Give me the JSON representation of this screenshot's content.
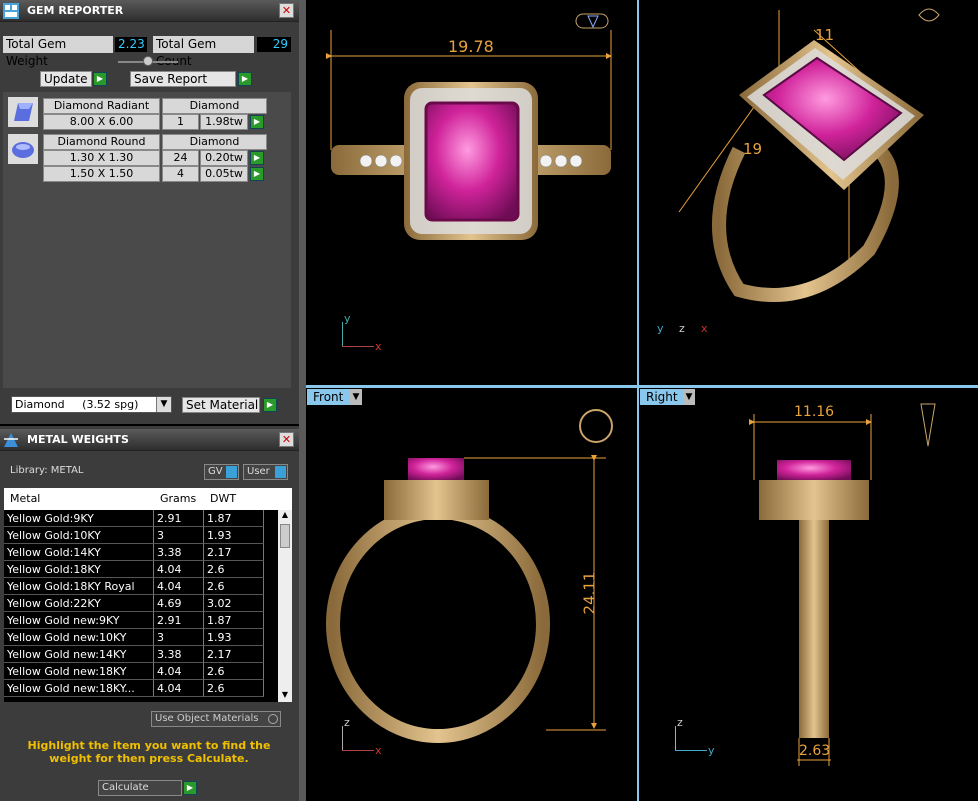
{
  "gem_reporter": {
    "title": "GEM REPORTER",
    "close": "✕",
    "total_weight_label": "Total Gem Weight",
    "total_weight": "2.23",
    "total_count_label": "Total Gem Count",
    "total_count": "29",
    "update_label": "Update",
    "save_label": "Save Report",
    "gems": [
      {
        "name": "Diamond Radiant",
        "material": "Diamond",
        "rows": [
          {
            "size": "8.00 X 6.00",
            "count": "1",
            "weight": "1.98tw"
          }
        ]
      },
      {
        "name": "Diamond Round",
        "material": "Diamond",
        "rows": [
          {
            "size": "1.30 X 1.30",
            "count": "24",
            "weight": "0.20tw"
          },
          {
            "size": "1.50 X 1.50",
            "count": "4",
            "weight": "0.05tw"
          }
        ]
      }
    ],
    "material_select": "Diamond     (3.52 spg)",
    "set_material_label": "Set Material"
  },
  "metal_weights": {
    "title": "METAL WEIGHTS",
    "close": "✕",
    "library_label": "Library: METAL",
    "gv_label": "GV",
    "user_label": "User",
    "columns": [
      "Metal",
      "Grams",
      "DWT"
    ],
    "rows": [
      [
        "Yellow Gold:9KY",
        "2.91",
        "1.87"
      ],
      [
        "Yellow Gold:10KY",
        "3",
        "1.93"
      ],
      [
        "Yellow Gold:14KY",
        "3.38",
        "2.17"
      ],
      [
        "Yellow Gold:18KY",
        "4.04",
        "2.6"
      ],
      [
        "Yellow Gold:18KY Royal",
        "4.04",
        "2.6"
      ],
      [
        "Yellow Gold:22KY",
        "4.69",
        "3.02"
      ],
      [
        "Yellow Gold new:9KY",
        "2.91",
        "1.87"
      ],
      [
        "Yellow Gold new:10KY",
        "3",
        "1.93"
      ],
      [
        "Yellow Gold new:14KY",
        "3.38",
        "2.17"
      ],
      [
        "Yellow Gold new:18KY",
        "4.04",
        "2.6"
      ],
      [
        "Yellow Gold new:18KY...",
        "4.04",
        "2.6"
      ]
    ],
    "use_object_label": "Use Object Materials",
    "hint": "Highlight the item you want to find the weight for then press Calculate.",
    "calculate_label": "Calculate"
  },
  "viewports": {
    "top": {
      "dim": "19.78",
      "ax1": "y",
      "ax2": "x"
    },
    "persp": {
      "dim1": "11",
      "dim2": "19",
      "ax1": "y",
      "ax2": "z",
      "ax3": "x"
    },
    "front": {
      "label": "Front",
      "dim": "24.11",
      "ax1": "z",
      "ax2": "x"
    },
    "right": {
      "label": "Right",
      "dim1": "11.16",
      "dim2": "2.63",
      "ax1": "z",
      "ax2": "y"
    }
  },
  "colors": {
    "accent": "#8ac7ec",
    "dim": "#e8a23c",
    "gold": "#c9a36a",
    "ruby": "#d0239a",
    "hint": "#f0c000"
  }
}
